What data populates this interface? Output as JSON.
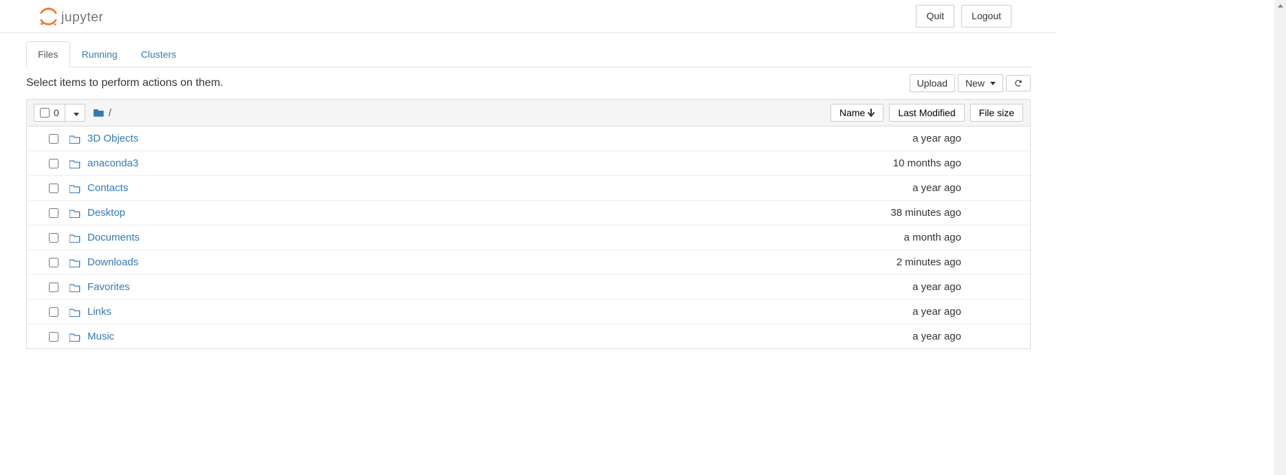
{
  "header": {
    "logo_text": "jupyter",
    "quit_label": "Quit",
    "logout_label": "Logout"
  },
  "tabs": {
    "files": "Files",
    "running": "Running",
    "clusters": "Clusters"
  },
  "toolbar": {
    "hint": "Select items to perform actions on them.",
    "upload_label": "Upload",
    "new_label": "New"
  },
  "list_header": {
    "selected_count": "0",
    "breadcrumb_sep": "/",
    "col_name": "Name",
    "col_modified": "Last Modified",
    "col_size": "File size"
  },
  "files": [
    {
      "name": "3D Objects",
      "modified": "a year ago",
      "size": ""
    },
    {
      "name": "anaconda3",
      "modified": "10 months ago",
      "size": ""
    },
    {
      "name": "Contacts",
      "modified": "a year ago",
      "size": ""
    },
    {
      "name": "Desktop",
      "modified": "38 minutes ago",
      "size": ""
    },
    {
      "name": "Documents",
      "modified": "a month ago",
      "size": ""
    },
    {
      "name": "Downloads",
      "modified": "2 minutes ago",
      "size": ""
    },
    {
      "name": "Favorites",
      "modified": "a year ago",
      "size": ""
    },
    {
      "name": "Links",
      "modified": "a year ago",
      "size": ""
    },
    {
      "name": "Music",
      "modified": "a year ago",
      "size": ""
    }
  ]
}
